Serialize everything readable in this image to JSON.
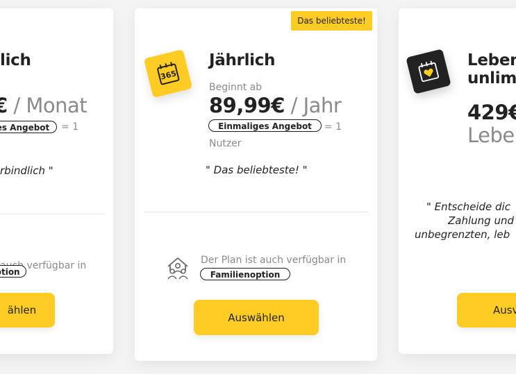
{
  "left_card": {
    "title": "lich",
    "price_tail": "€",
    "price_per": " / Monat",
    "pill": "es Angebot",
    "users": "= 1",
    "quote": "rbindlich \"",
    "family_text": "auch verfügbar in",
    "family_pill": "ption",
    "button": "ählen"
  },
  "middle_card": {
    "badge": "Das beliebteste!",
    "icon_text": "365",
    "title": "Jährlich",
    "starts": "Beginnt ab",
    "price": "89,99€",
    "price_per": " / Jahr",
    "pill": "Einmaliges Angebot",
    "users": "= 1",
    "users_label": "Nutzer",
    "quote": "\" Das beliebteste! \"",
    "family_text": "Der Plan ist auch verfügbar in",
    "family_pill": "Familienoption",
    "button": "Auswählen"
  },
  "right_card": {
    "title_line1": "Leben",
    "title_line2": "unlimi",
    "price": "429€",
    "price_per": "Lebe",
    "quote_line1": "\" Entscheide dic",
    "quote_line2": "Zahlung und",
    "quote_line3": "unbegrenzten, leb",
    "button": "Ausv"
  },
  "colors": {
    "accent": "#ffcc24",
    "dark": "#222222",
    "muted": "#8a8a8a"
  }
}
